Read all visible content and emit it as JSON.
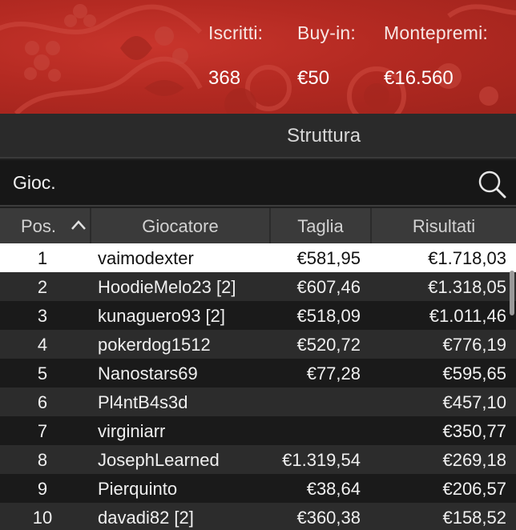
{
  "header": {
    "entries_label": "Iscritti:",
    "entries_value": "368",
    "buyin_label": "Buy-in:",
    "buyin_value": "€50",
    "prize_label": "Montepremi:",
    "prize_value": "€16.560"
  },
  "tab": {
    "label": "Struttura"
  },
  "search": {
    "placeholder": "Gioc."
  },
  "table": {
    "headers": {
      "pos": "Pos.",
      "player": "Giocatore",
      "size": "Taglia",
      "result": "Risultati"
    },
    "rows": [
      {
        "pos": "1",
        "player": "vaimodexter",
        "size": "€581,95",
        "result": "€1.718,03"
      },
      {
        "pos": "2",
        "player": "HoodieMelo23 [2]",
        "size": "€607,46",
        "result": "€1.318,05"
      },
      {
        "pos": "3",
        "player": "kunaguero93 [2]",
        "size": "€518,09",
        "result": "€1.011,46"
      },
      {
        "pos": "4",
        "player": "pokerdog1512",
        "size": "€520,72",
        "result": "€776,19"
      },
      {
        "pos": "5",
        "player": "Nanostars69",
        "size": "€77,28",
        "result": "€595,65"
      },
      {
        "pos": "6",
        "player": "Pl4ntB4s3d",
        "size": "",
        "result": "€457,10"
      },
      {
        "pos": "7",
        "player": "virginiarr",
        "size": "",
        "result": "€350,77"
      },
      {
        "pos": "8",
        "player": "JosephLearned",
        "size": "€1.319,54",
        "result": "€269,18"
      },
      {
        "pos": "9",
        "player": "Pierquinto",
        "size": "€38,64",
        "result": "€206,57"
      },
      {
        "pos": "10",
        "player": "davadi82 [2]",
        "size": "€360,38",
        "result": "€158,52"
      }
    ]
  },
  "icons": {
    "search": "search-icon",
    "sort": "chevron-up-icon"
  },
  "colors": {
    "banner": "#b42a22",
    "selected_row": "#ffffff"
  }
}
